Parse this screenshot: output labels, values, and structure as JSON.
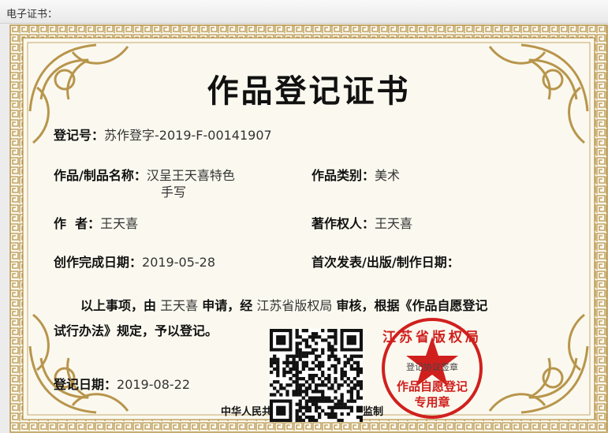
{
  "window": {
    "title": "电子证书："
  },
  "certificate": {
    "title": "作品登记证书",
    "reg_no_label": "登记号：",
    "reg_no": "苏作登字-2019-F-00141907",
    "work_name_label": "作品/制品名称：",
    "work_name_line1": "汉呈王天喜特色",
    "work_name_line2": "手写",
    "category_label": "作品类别：",
    "category": "美术",
    "author_label": "作  者：",
    "author": "王天喜",
    "owner_label": "著作权人：",
    "owner": "王天喜",
    "completion_label": "创作完成日期：",
    "completion_date": "2019-05-28",
    "publish_label": "首次发表/出版/制作日期：",
    "body_p1": "以上事项，由",
    "body_applicant": "王天喜",
    "body_p2": "申请，经",
    "body_authority": "江苏省版权局",
    "body_p3": "审核，根据《作品自愿登记",
    "body_line2": "试行办法》规定，予以登记。",
    "reg_date_label": "登记日期：",
    "reg_date": "2019-08-22",
    "footer_left": "中华人民共",
    "footer_right": "监制",
    "seal": {
      "color": "#d0201e",
      "top_text": "江苏省版权局",
      "mid_text": "登记协议签章",
      "bottom_line1": "作品自愿登记",
      "bottom_line2": "专用章"
    },
    "colors": {
      "gold": "#b8954c",
      "paper": "#fbf9ef"
    }
  }
}
